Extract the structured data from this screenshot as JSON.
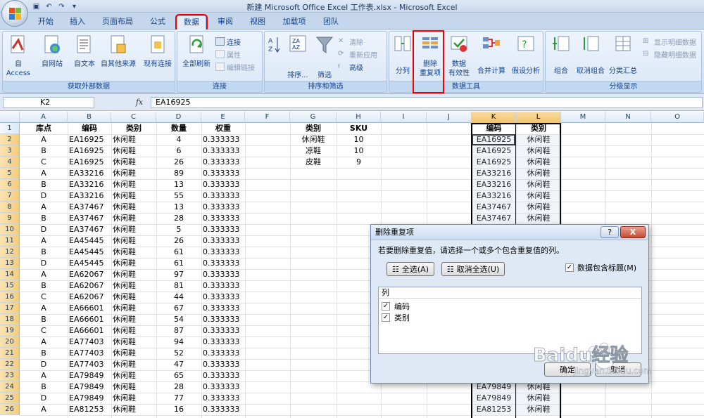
{
  "window": {
    "title": "新建 Microsoft Office Excel 工作表.xlsx - Microsoft Excel"
  },
  "tabs": [
    "开始",
    "插入",
    "页面布局",
    "公式",
    "数据",
    "审阅",
    "视图",
    "加载项",
    "团队"
  ],
  "active_tab": "数据",
  "ribbon": {
    "get_external": {
      "label": "获取外部数据",
      "buttons": [
        "自 Access",
        "自网站",
        "自文本",
        "自其他来源",
        "现有连接"
      ]
    },
    "connections": {
      "label": "连接",
      "refresh": "全部刷新",
      "small": [
        "连接",
        "属性",
        "编辑链接"
      ]
    },
    "sort_filter": {
      "label": "排序和筛选",
      "sort": "排序...",
      "filter": "筛选",
      "small": [
        "清除",
        "重新应用",
        "高级"
      ]
    },
    "data_tools": {
      "label": "数据工具",
      "split": "分列",
      "remove_dup": "删除\n重复项",
      "validate": "数据\n有效性",
      "consolidate": "合并计算",
      "whatif": "假设分析"
    },
    "outline": {
      "label": "分级显示",
      "group": "组合",
      "ungroup": "取消组合",
      "subtotal": "分类汇总",
      "small": [
        "显示明细数据",
        "隐藏明细数据"
      ]
    }
  },
  "formula_bar": {
    "name_box": "K2",
    "fx": "fx",
    "formula": "EA16925"
  },
  "columns": [
    "A",
    "B",
    "C",
    "D",
    "E",
    "F",
    "G",
    "H",
    "I",
    "J",
    "K",
    "L",
    "M",
    "N",
    "O"
  ],
  "rows": [
    "1",
    "2",
    "3",
    "4",
    "5",
    "6",
    "7",
    "8",
    "9",
    "10",
    "11",
    "12",
    "13",
    "14",
    "15",
    "16",
    "17",
    "18",
    "19",
    "20",
    "21",
    "22",
    "23",
    "24",
    "25",
    "26"
  ],
  "table_main": {
    "headers": [
      "库点",
      "编码",
      "类别",
      "数量",
      "权重"
    ],
    "rows": [
      [
        "A",
        "EA16925",
        "休闲鞋",
        "4",
        "0.333333"
      ],
      [
        "B",
        "EA16925",
        "休闲鞋",
        "6",
        "0.333333"
      ],
      [
        "C",
        "EA16925",
        "休闲鞋",
        "26",
        "0.333333"
      ],
      [
        "A",
        "EA33216",
        "休闲鞋",
        "89",
        "0.333333"
      ],
      [
        "B",
        "EA33216",
        "休闲鞋",
        "13",
        "0.333333"
      ],
      [
        "D",
        "EA33216",
        "休闲鞋",
        "55",
        "0.333333"
      ],
      [
        "A",
        "EA37467",
        "休闲鞋",
        "13",
        "0.333333"
      ],
      [
        "B",
        "EA37467",
        "休闲鞋",
        "28",
        "0.333333"
      ],
      [
        "D",
        "EA37467",
        "休闲鞋",
        "5",
        "0.333333"
      ],
      [
        "A",
        "EA45445",
        "休闲鞋",
        "26",
        "0.333333"
      ],
      [
        "B",
        "EA45445",
        "休闲鞋",
        "61",
        "0.333333"
      ],
      [
        "D",
        "EA45445",
        "休闲鞋",
        "61",
        "0.333333"
      ],
      [
        "A",
        "EA62067",
        "休闲鞋",
        "97",
        "0.333333"
      ],
      [
        "B",
        "EA62067",
        "休闲鞋",
        "81",
        "0.333333"
      ],
      [
        "C",
        "EA62067",
        "休闲鞋",
        "44",
        "0.333333"
      ],
      [
        "A",
        "EA66601",
        "休闲鞋",
        "67",
        "0.333333"
      ],
      [
        "B",
        "EA66601",
        "休闲鞋",
        "54",
        "0.333333"
      ],
      [
        "C",
        "EA66601",
        "休闲鞋",
        "87",
        "0.333333"
      ],
      [
        "A",
        "EA77403",
        "休闲鞋",
        "94",
        "0.333333"
      ],
      [
        "B",
        "EA77403",
        "休闲鞋",
        "52",
        "0.333333"
      ],
      [
        "D",
        "EA77403",
        "休闲鞋",
        "47",
        "0.333333"
      ],
      [
        "A",
        "EA79849",
        "休闲鞋",
        "65",
        "0.333333"
      ],
      [
        "B",
        "EA79849",
        "休闲鞋",
        "28",
        "0.333333"
      ],
      [
        "D",
        "EA79849",
        "休闲鞋",
        "77",
        "0.333333"
      ],
      [
        "A",
        "EA81253",
        "休闲鞋",
        "16",
        "0.333333"
      ]
    ]
  },
  "table_sku": {
    "headers": [
      "类别",
      "SKU"
    ],
    "rows": [
      [
        "休闲鞋",
        "10"
      ],
      [
        "凉鞋",
        "10"
      ],
      [
        "皮鞋",
        "9"
      ]
    ]
  },
  "table_kl": {
    "headers": [
      "编码",
      "类别"
    ],
    "rows": [
      [
        "EA16925",
        "休闲鞋"
      ],
      [
        "EA16925",
        "休闲鞋"
      ],
      [
        "EA16925",
        "休闲鞋"
      ],
      [
        "EA33216",
        "休闲鞋"
      ],
      [
        "EA33216",
        "休闲鞋"
      ],
      [
        "EA33216",
        "休闲鞋"
      ],
      [
        "EA37467",
        "休闲鞋"
      ],
      [
        "EA37467",
        "休闲鞋"
      ],
      [
        "",
        "",
        ""
      ],
      [
        "",
        "",
        ""
      ],
      [
        "",
        "",
        ""
      ],
      [
        "",
        "",
        ""
      ],
      [
        "",
        "",
        ""
      ],
      [
        "",
        "",
        ""
      ],
      [
        "",
        "",
        ""
      ],
      [
        "",
        "",
        ""
      ],
      [
        "",
        "",
        ""
      ],
      [
        "",
        "",
        ""
      ],
      [
        "",
        "",
        ""
      ],
      [
        "",
        "",
        ""
      ],
      [
        "",
        "",
        ""
      ],
      [
        "",
        "",
        ""
      ],
      [
        "EA79849",
        "休闲鞋"
      ],
      [
        "EA79849",
        "休闲鞋"
      ],
      [
        "EA81253",
        "休闲鞋"
      ]
    ]
  },
  "dialog": {
    "title": "删除重复项",
    "help": "?",
    "close": "X",
    "message": "若要删除重复值，请选择一个或多个包含重复值的列。",
    "select_all": "全选(A)",
    "unselect_all": "取消全选(U)",
    "has_headers": "数据包含标题(M)",
    "list_header": "列",
    "columns": [
      "编码",
      "类别"
    ],
    "ok": "确定",
    "cancel": "取消"
  },
  "watermark": {
    "text": "Baidu经验",
    "url": "jingyan.baidu.com"
  }
}
